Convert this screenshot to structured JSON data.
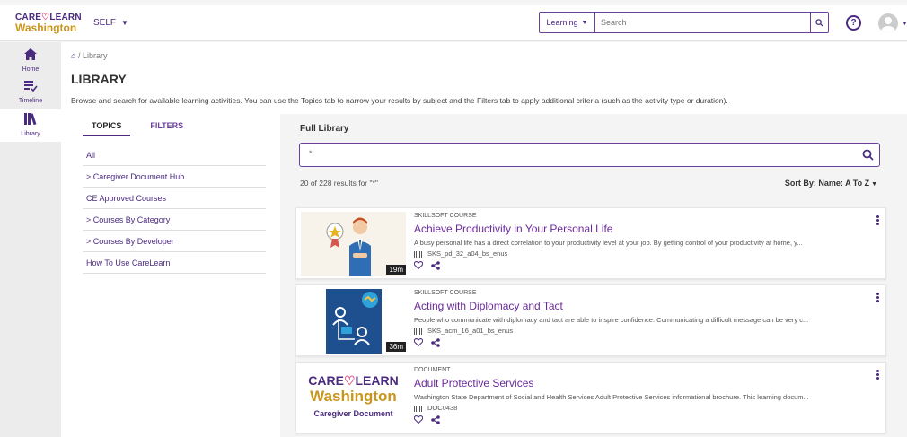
{
  "topbar": {
    "logo_line1_a": "CARE",
    "logo_line1_b": "LEARN",
    "logo_line2": "Washington",
    "self_label": "SELF",
    "search_category": "Learning",
    "search_placeholder": "Search"
  },
  "nav": {
    "home": "Home",
    "timeline": "Timeline",
    "library": "Library"
  },
  "header": {
    "breadcrumb_current": "Library",
    "title": "LIBRARY",
    "description": "Browse and search for available learning activities. You can use the Topics tab to narrow your results by subject and the Filters tab to apply additional criteria (such as the activity type or duration)."
  },
  "tabs": {
    "topics": "TOPICS",
    "filters": "FILTERS"
  },
  "topics": [
    "All",
    "> Caregiver Document Hub",
    "CE Approved Courses",
    "> Courses By Category",
    "> Courses By Developer",
    "How To Use CareLearn"
  ],
  "main": {
    "heading": "Full Library",
    "search_value": "*",
    "result_count": "20 of 228 results for \"*\"",
    "sort_label": "Sort By: Name: A To Z"
  },
  "cards": [
    {
      "type": "SKILLSOFT COURSE",
      "title": "Achieve Productivity in Your Personal Life",
      "desc": "A busy personal life has a direct correlation to your productivity level at your job. By getting control of your productivity at home, y...",
      "code": "SKS_pd_32_a04_bs_enus",
      "duration": "19m"
    },
    {
      "type": "SKILLSOFT COURSE",
      "title": "Acting with Diplomacy and Tact",
      "desc": "People who communicate with diplomacy and tact are able to inspire confidence. Communicating a difficult message can be very c...",
      "code": "SKS_acm_16_a01_bs_enus",
      "duration": "36m"
    },
    {
      "type": "DOCUMENT",
      "title": "Adult Protective Services",
      "desc": "Washington State Department of Social and Health Services Adult Protective Services informational brochure. This learning docum...",
      "code": "DOC0438",
      "thumb_line1_a": "CARE",
      "thumb_line1_b": "LEARN",
      "thumb_line2": "Washington",
      "thumb_line3": "Caregiver Document"
    }
  ],
  "colors": {
    "brand_purple": "#4b2b7f",
    "brand_gold": "#c8961e",
    "link_purple": "#6b2a9a"
  }
}
